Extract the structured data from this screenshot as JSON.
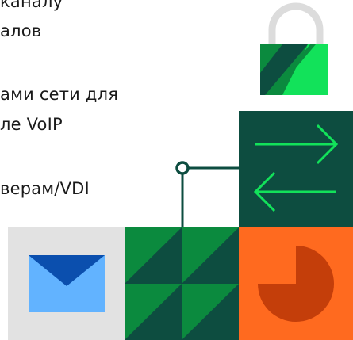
{
  "feature_lines": [
    "каналу",
    "алов",
    "ами сети для",
    "ле VoIP",
    "верам/VDI"
  ],
  "colors": {
    "dark_green": "#0d4d40",
    "mid_green": "#0b8a3e",
    "bright_green": "#12e25a",
    "orange": "#ff6a1f",
    "dark_orange": "#c43e0a",
    "envelope_light": "#62b3ff",
    "envelope_dark": "#0b4fae",
    "tile_grey": "#e2e2e2",
    "lock_shackle": "#dcdcdc"
  },
  "icons": [
    "lock-icon",
    "arrows-icon",
    "envelope-icon",
    "pie-chart-icon",
    "connector-node-icon"
  ]
}
